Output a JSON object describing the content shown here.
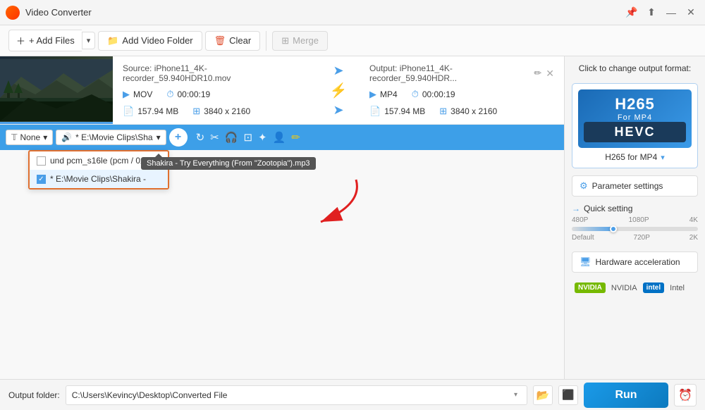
{
  "app": {
    "title": "Video Converter",
    "icon": "🎬"
  },
  "titlebar": {
    "pin_label": "📌",
    "share_label": "⬆",
    "minimize_label": "—",
    "close_label": "✕"
  },
  "toolbar": {
    "add_files_label": "+ Add Files",
    "add_video_folder_label": "Add Video Folder",
    "clear_label": "Clear",
    "merge_label": "Merge"
  },
  "file": {
    "source_label": "Source: iPhone11_4K-recorder_59.940HDR10.mov",
    "format": "MOV",
    "duration": "00:00:19",
    "size": "157.94 MB",
    "resolution": "3840 x 2160",
    "output_label": "Output: iPhone11_4K-recorder_59.940HDR...",
    "output_format": "MP4",
    "output_duration": "00:00:19",
    "output_size": "157.94 MB",
    "output_resolution": "3840 x 2160"
  },
  "audio": {
    "track_label": "* E:\\Movie Clips\\Sha",
    "track1_label": "und pcm_s16le (pcm / 0x...",
    "track2_label": "* E:\\Movie Clips\\Shakira -",
    "tooltip": "Shakira - Try Everything (From \"Zootopia\").mp3"
  },
  "right_panel": {
    "format_change_label": "Click to change output format:",
    "format_name": "H265 for MP4",
    "h265_label": "H265",
    "for_mp4_label": "For MP4",
    "hevc_label": "HEVC",
    "param_settings_label": "Parameter settings",
    "quick_setting_label": "Quick setting",
    "quality_480p": "480P",
    "quality_1080p": "1080P",
    "quality_4k": "4K",
    "quality_default": "Default",
    "quality_720p": "720P",
    "quality_2k": "2K",
    "hw_accel_label": "Hardware acceleration",
    "nvidia_label": "NVIDIA",
    "intel_label": "Intel"
  },
  "bottom": {
    "output_folder_label": "Output folder:",
    "output_folder_path": "C:\\Users\\Kevincy\\Desktop\\Converted File",
    "run_label": "Run"
  }
}
